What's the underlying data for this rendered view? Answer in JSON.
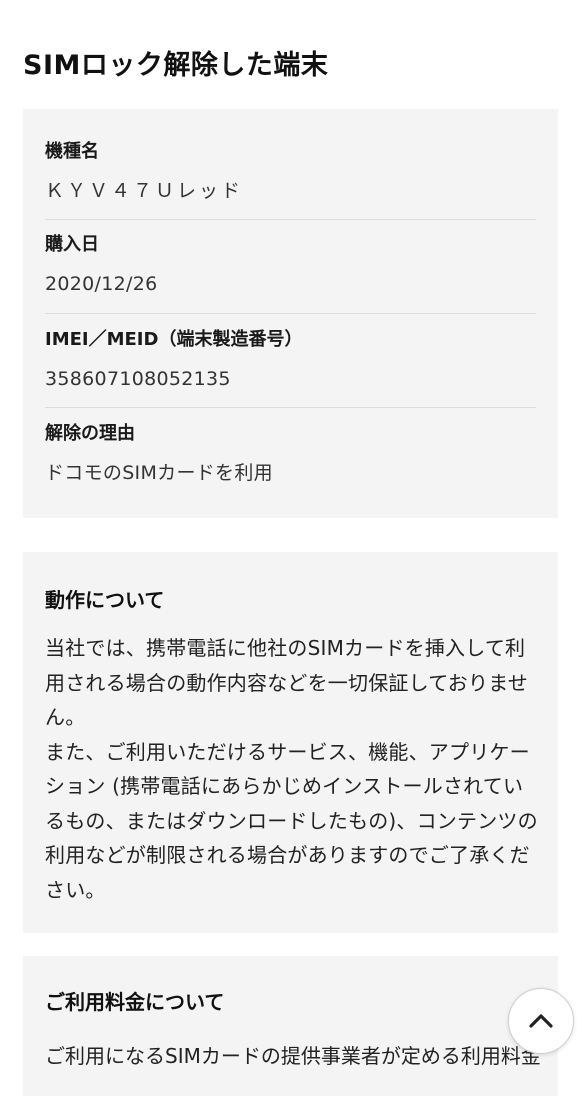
{
  "page": {
    "title": "SIMロック解除した端末"
  },
  "device": {
    "model_label": "機種名",
    "model_value": "ＫＹＶ４７Ｕレッド",
    "purchase_date_label": "購入日",
    "purchase_date_value": "2020/12/26",
    "imei_label": "IMEI／MEID（端末製造番号）",
    "imei_value": "358607108052135",
    "reason_label": "解除の理由",
    "reason_value": "ドコモのSIMカードを利用"
  },
  "operation": {
    "heading": "動作について",
    "paragraph_1": "当社では、携帯電話に他社のSIMカードを挿入して利用される場合の動作内容などを一切保証しておりません。",
    "paragraph_2": "また、ご利用いただけるサービス、機能、アプリケーション (携帯電話にあらかじめインストールされているもの、またはダウンロードしたもの)、コンテンツの利用などが制限される場合がありますのでご了承ください。"
  },
  "fees": {
    "heading": "ご利用料金について",
    "body": "ご利用になるSIMカードの提供事業者が定める利用料金がかかります。"
  },
  "controls": {
    "scroll_top_icon": "chevron-up-icon"
  }
}
